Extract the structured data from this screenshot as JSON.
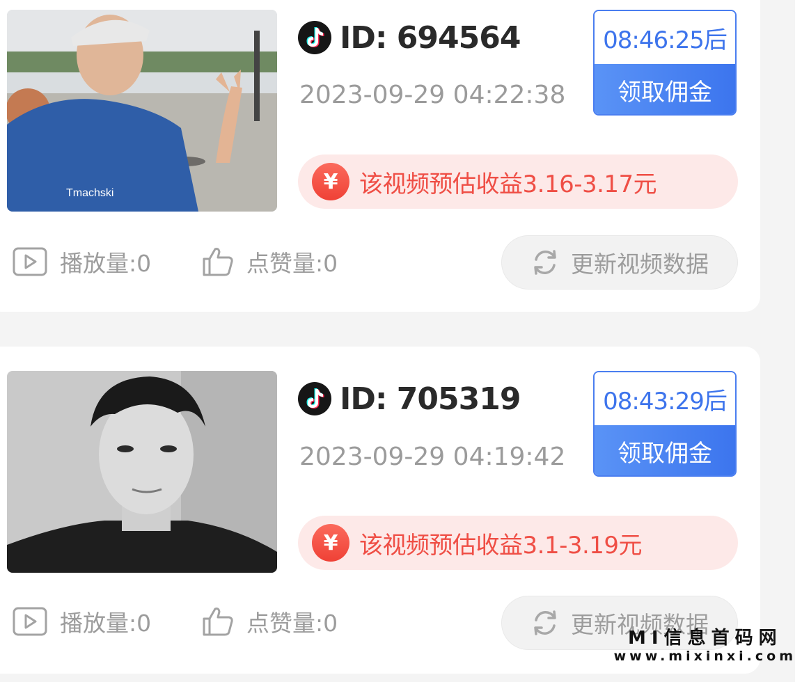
{
  "cards": [
    {
      "video_id": "ID: 694564",
      "timestamp": "2023-09-29 04:22:38",
      "countdown": "08:46:25后",
      "claim_label": "领取佣金",
      "earnings": "该视频预估收益3.16-3.17元",
      "plays": "播放量:0",
      "likes": "点赞量:0",
      "refresh_label": "更新视频数据"
    },
    {
      "video_id": "ID: 705319",
      "timestamp": "2023-09-29 04:19:42",
      "countdown": "08:43:29后",
      "claim_label": "领取佣金",
      "earnings": "该视频预估收益3.1-3.19元",
      "plays": "播放量:0",
      "likes": "点赞量:0",
      "refresh_label": "更新视频数据"
    }
  ],
  "yen_symbol": "¥",
  "watermark": {
    "title": "MI信息首码网",
    "url": "www.mixinxi.com"
  },
  "colors": {
    "accent_blue": "#3d74ec",
    "earn_red": "#ef4e45",
    "earn_bg": "#fde9e8",
    "muted_text": "#9c9c9c"
  },
  "icons": {
    "platform": "tiktok-icon",
    "earnings": "yen-icon",
    "plays": "play-icon",
    "likes": "thumbs-up-icon",
    "refresh": "refresh-icon"
  }
}
